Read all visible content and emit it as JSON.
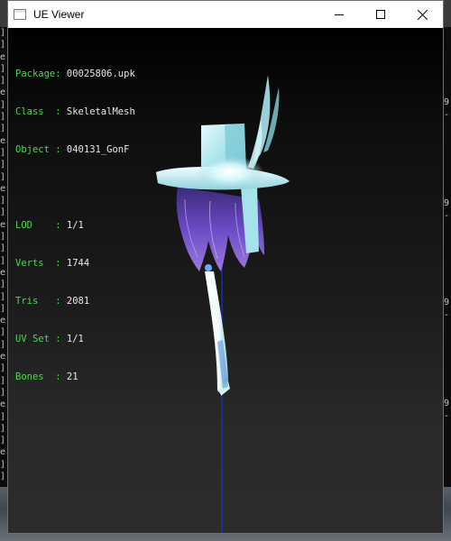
{
  "window": {
    "title": "UE Viewer"
  },
  "info": {
    "package_label": "Package:",
    "package_value": "00025806.upk",
    "class_label": "Class  :",
    "class_value": "SkeletalMesh",
    "object_label": "Object :",
    "object_value": "040131_GonF",
    "lod_label": "LOD    :",
    "lod_value": "1/1",
    "verts_label": "Verts  :",
    "verts_value": "1744",
    "tris_label": "Tris   :",
    "tris_value": "2081",
    "uvset_label": "UV Set :",
    "uvset_value": "1/1",
    "bones_label": "Bones  :",
    "bones_value": "21"
  },
  "colors": {
    "label_green": "#4ad94a",
    "value_white": "#e8e8e8",
    "mesh_cyan": "#bfeff5",
    "hair_purple": "#7a55c8",
    "bone_line_blue": "#1a2fd0"
  },
  "icons": {
    "app": "window-app-icon",
    "minimize": "minimize-icon",
    "maximize": "maximize-icon",
    "close": "close-icon"
  }
}
